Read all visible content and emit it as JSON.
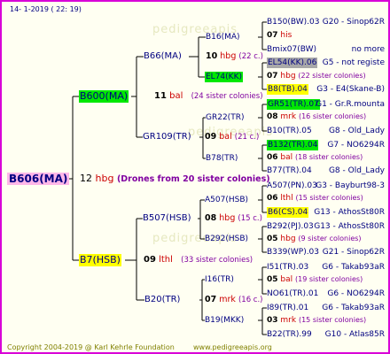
{
  "header": {
    "date": "14-  1-2019 (  22: 19)"
  },
  "footer": {
    "copyright": "Copyright 2004-2019 @ Karl Kehrle Foundation",
    "website": "www.pedigreeapis.org"
  },
  "watermark": "pedigreeapis",
  "root": {
    "name": "B606(MA)",
    "cross_num": "12",
    "cross_id": "hbg",
    "note": "(Drones from 20 sister colonies)"
  },
  "sire": {
    "name": "B600(MA)",
    "cross_num": "11",
    "cross_id": "bal",
    "note": "(24 sister colonies)",
    "sire": {
      "name": "B66(MA)",
      "cross_num": "10",
      "cross_id": "hbg",
      "note": "(22 c.)",
      "sire": {
        "name": "B16(MA)",
        "cross_num": "07",
        "cross_id": "his",
        "sire": {
          "name": "B150(BW).03",
          "breeder": "G20 - Sinop62R"
        },
        "dam": {
          "name": "Bmix07(BW)",
          "breeder": "no more"
        }
      },
      "dam": {
        "name": "EL74(KK)",
        "cross_num": "07",
        "cross_id": "hbg",
        "note": "(22 sister colonies)",
        "sire": {
          "name": "EL54(KK).06",
          "breeder": "G5 - not registe"
        },
        "dam": {
          "name": "B8(TB).04",
          "breeder": "G3 - E4(Skane-B)"
        }
      }
    },
    "dam": {
      "name": "GR109(TR)",
      "cross_num": "09",
      "cross_id": "bal",
      "note": "(21 c.)",
      "sire": {
        "name": "GR22(TR)",
        "cross_num": "08",
        "cross_id": "mrk",
        "note": "(16 sister colonies)",
        "sire": {
          "name": "GR51(TR).07",
          "breeder": "G1 - Gr.R.mounta"
        },
        "dam": {
          "name": "B10(TR).05",
          "breeder": "G8 - Old_Lady"
        }
      },
      "dam": {
        "name": "B78(TR)",
        "cross_num": "06",
        "cross_id": "bal",
        "note": "(18 sister colonies)",
        "sire": {
          "name": "B132(TR).04",
          "breeder": "G7 - NO6294R"
        },
        "dam": {
          "name": "B77(TR).04",
          "breeder": "G8 - Old_Lady"
        }
      }
    }
  },
  "dam": {
    "name": "B7(HSB)",
    "cross_num": "09",
    "cross_id": "lthl",
    "note": "(33 sister colonies)",
    "sire": {
      "name": "B507(HSB)",
      "cross_num": "08",
      "cross_id": "hbg",
      "note": "(15 c.)",
      "sire": {
        "name": "A507(HSB)",
        "cross_num": "06",
        "cross_id": "lthl",
        "note": "(15 sister colonies)",
        "sire": {
          "name": "A507(PN).03",
          "breeder": "G3 - Bayburt98-3"
        },
        "dam": {
          "name": "B6(CS).04",
          "breeder": "G13 - AthosSt80R"
        }
      },
      "dam": {
        "name": "B292(HSB)",
        "cross_num": "05",
        "cross_id": "hbg",
        "note": "(9 sister colonies)",
        "sire": {
          "name": "B292(PJ).03",
          "breeder": "G13 - AthosSt80R"
        },
        "dam": {
          "name": "B339(WP).03",
          "breeder": "G21 - Sinop62R"
        }
      }
    },
    "dam": {
      "name": "B20(TR)",
      "cross_num": "07",
      "cross_id": "mrk",
      "note": "(16 c.)",
      "sire": {
        "name": "I16(TR)",
        "cross_num": "05",
        "cross_id": "bal",
        "note": "(19 sister colonies)",
        "sire": {
          "name": "I51(TR).03",
          "breeder": "G6 - Takab93aR"
        },
        "dam": {
          "name": "NO61(TR).01",
          "breeder": "G6 - NO6294R"
        }
      },
      "dam": {
        "name": "B19(MKK)",
        "cross_num": "03",
        "cross_id": "mrk",
        "note": "(15 sister colonies)",
        "sire": {
          "name": "I89(TR).01",
          "breeder": "G6 - Takab93aR"
        },
        "dam": {
          "name": "B22(TR).99",
          "breeder": "G10 - Atlas85R"
        }
      }
    }
  }
}
